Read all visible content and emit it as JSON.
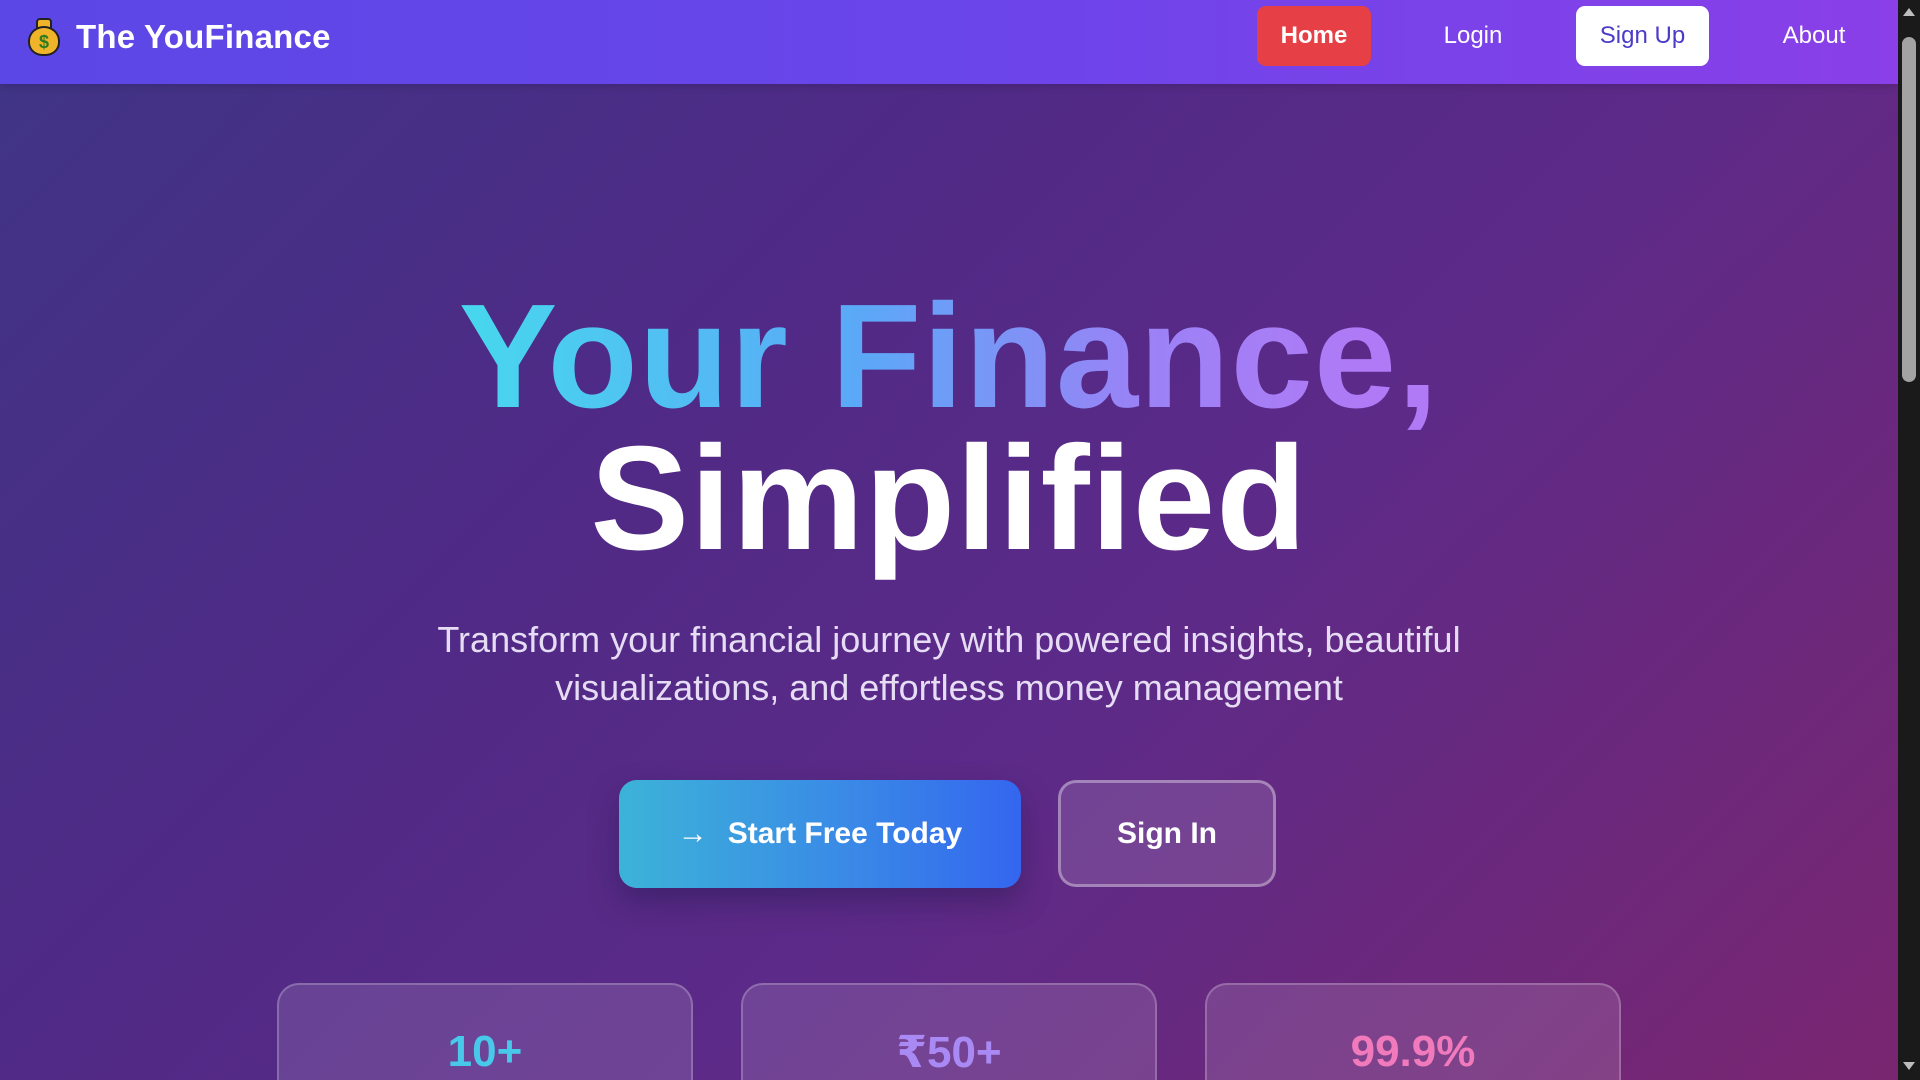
{
  "nav": {
    "brand_icon": "money-bag-icon",
    "brand_icon_glyph": "$",
    "brand_title": "The YouFinance",
    "home": "Home",
    "login": "Login",
    "signup": "Sign Up",
    "about": "About"
  },
  "hero": {
    "line1": "Your Finance,",
    "line2": "Simplified",
    "subtitle_line1": "Transform your financial journey with powered insights, beautiful",
    "subtitle_line2": "visualizations, and effortless money management",
    "primary_button": "Start Free Today",
    "primary_button_icon": "arrow-right-icon",
    "secondary_button": "Sign In"
  },
  "stats": [
    {
      "value": "10+",
      "color": "#48c9ea"
    },
    {
      "value": "₹50+",
      "color": "#a98af5"
    },
    {
      "value": "99.9%",
      "color": "#f07abb"
    }
  ],
  "colors": {
    "nav_home_bg": "#e63f45",
    "nav_bg_start": "#5b47e6",
    "nav_bg_end": "#8a3fe8",
    "accent_blue": "#3466ef"
  }
}
